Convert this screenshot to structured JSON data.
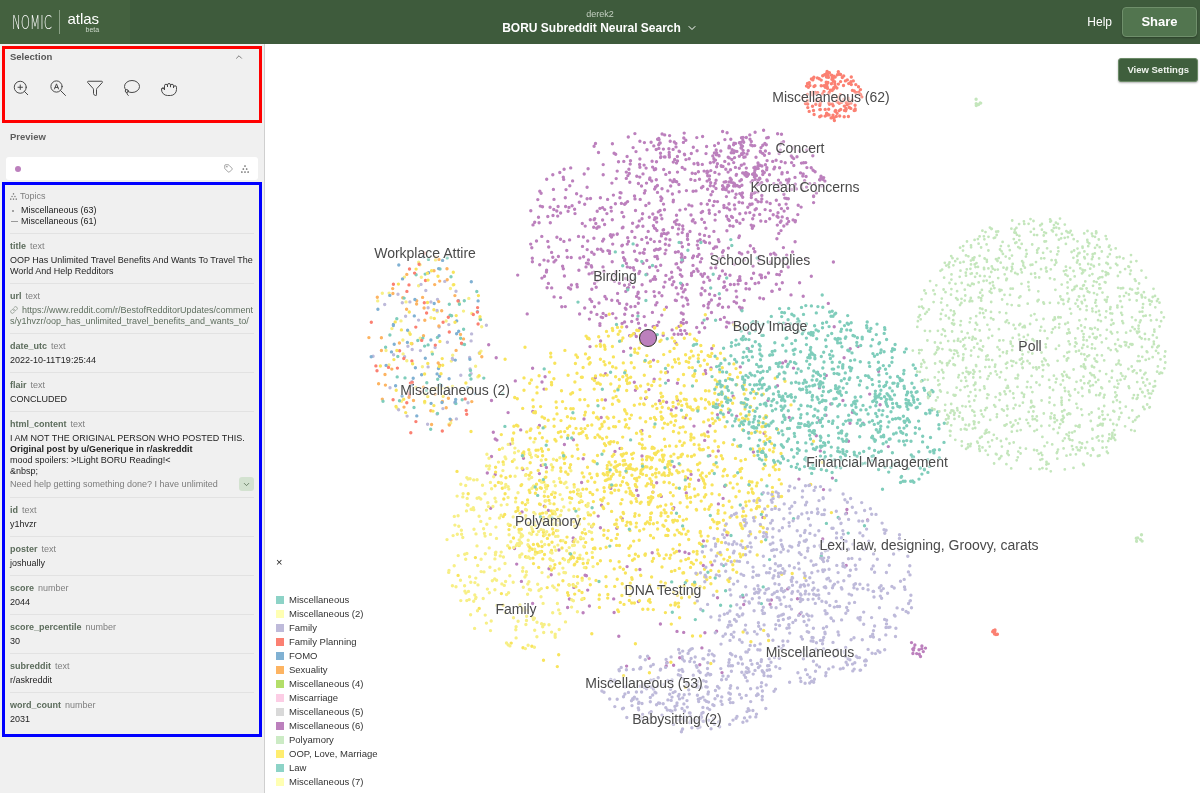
{
  "header": {
    "logo": "NOMIC",
    "product": "atlas",
    "badge": "beta",
    "user": "derek2",
    "project_title": "BORU Subreddit Neural Search",
    "help_link": "Help",
    "share_button": "Share"
  },
  "annotations": [
    {
      "color": "#ff0000"
    },
    {
      "color": "#0000ff"
    }
  ],
  "sidebar": {
    "selection": {
      "title": "Selection",
      "expanded": true
    },
    "preview": {
      "title": "Preview"
    },
    "topics": {
      "title": "Topics",
      "items": [
        {
          "label": "Miscellaneous (63)",
          "children": [
            {
              "label": "Miscellaneous (61)"
            }
          ]
        }
      ]
    },
    "fields": [
      {
        "name": "title",
        "type": "text",
        "kind": "plain",
        "value": "OOP Has Unlimited Travel Benefits And Wants To Travel The World And Help Redditors"
      },
      {
        "name": "url",
        "type": "text",
        "kind": "link",
        "value": "https://www.reddit.com/r/BestofRedditorUpdates/comments/y1hvzr/oop_has_unlimited_travel_benefits_and_wants_to/"
      },
      {
        "name": "date_utc",
        "type": "text",
        "kind": "plain",
        "value": "2022-10-11T19:25:44"
      },
      {
        "name": "flair",
        "type": "text",
        "kind": "plain",
        "value": "CONCLUDED"
      },
      {
        "name": "html_content",
        "type": "text",
        "kind": "html",
        "expanded": false,
        "lines": [
          "I AM NOT THE ORIGINAL PERSON WHO POSTED THIS.",
          "**Original post by u/Generique in r/askreddit**",
          "mood spoilers: >!Light BORU Reading!<",
          "&nbsp;",
          "Need help getting something done? I have unlimited"
        ]
      },
      {
        "name": "id",
        "type": "text",
        "kind": "plain",
        "value": "y1hvzr"
      },
      {
        "name": "poster",
        "type": "text",
        "kind": "plain",
        "value": "joshually"
      },
      {
        "name": "score",
        "type": "number",
        "kind": "plain",
        "value": "2044"
      },
      {
        "name": "score_percentile",
        "type": "number",
        "kind": "plain",
        "value": "30"
      },
      {
        "name": "subreddit",
        "type": "text",
        "kind": "plain",
        "value": "r/askreddit"
      },
      {
        "name": "word_count",
        "type": "number",
        "kind": "plain",
        "value": "2031"
      }
    ]
  },
  "map": {
    "view_settings_button": "View Settings",
    "labels": [
      "Miscellaneous (62)",
      "Concert",
      "Korean Concerns",
      "Workplace Attire",
      "School Supplies",
      "Birding",
      "Body Image",
      "Poll",
      "Miscellaneous (2)",
      "Financial Management",
      "Polyamory",
      "Lexi, law, designing, Groovy, carats",
      "DNA Testing",
      "Family",
      "Miscellaneous",
      "Miscellaneous (53)",
      "Babysitting (2)"
    ],
    "legend": {
      "close": "×",
      "items": [
        {
          "label": "Miscellaneous",
          "color": "#8dd3c7"
        },
        {
          "label": "Miscellaneous (2)",
          "color": "#ffffb3"
        },
        {
          "label": "Family",
          "color": "#bebada"
        },
        {
          "label": "Family Planning",
          "color": "#fb8072"
        },
        {
          "label": "FOMO",
          "color": "#80b1d3"
        },
        {
          "label": "Sexuality",
          "color": "#fdb462"
        },
        {
          "label": "Miscellaneous (4)",
          "color": "#b3de69"
        },
        {
          "label": "Miscarriage",
          "color": "#fccde5"
        },
        {
          "label": "Miscellaneous (5)",
          "color": "#d9d9d9"
        },
        {
          "label": "Miscellaneous (6)",
          "color": "#bc80bd"
        },
        {
          "label": "Polyamory",
          "color": "#ccebc5"
        },
        {
          "label": "OOP, Love, Marriage",
          "color": "#ffed6f"
        },
        {
          "label": "Law",
          "color": "#8dd3c7"
        },
        {
          "label": "Miscellaneous (7)",
          "color": "#ffffb3"
        }
      ]
    }
  }
}
